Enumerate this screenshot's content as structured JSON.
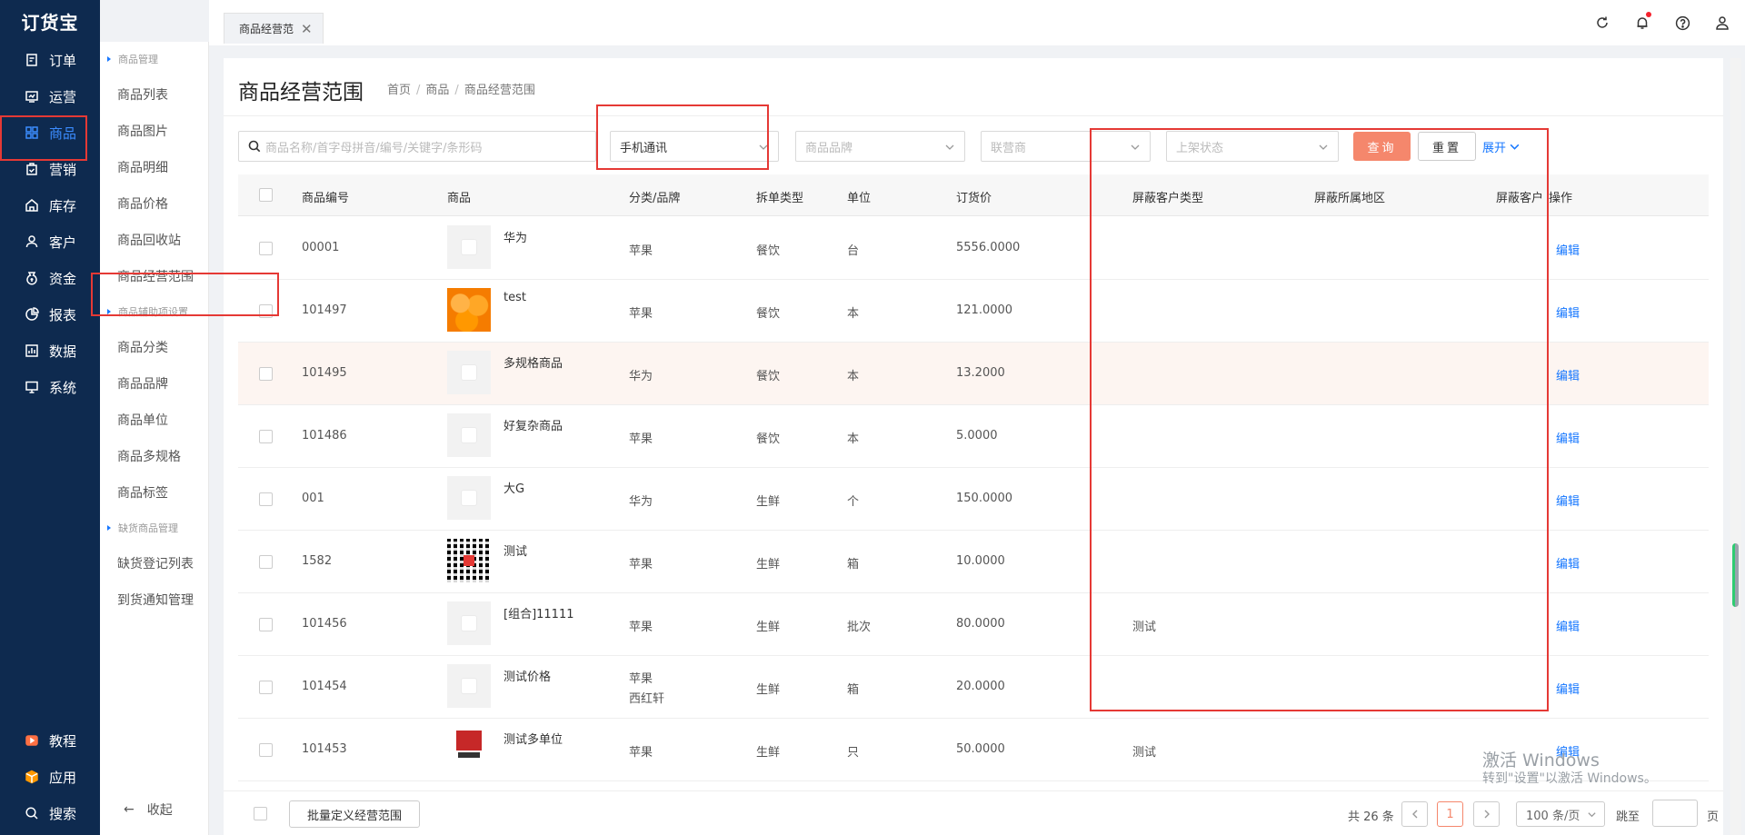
{
  "app": {
    "logo": "订货宝"
  },
  "nav": {
    "items": [
      {
        "label": "订单",
        "icon": "order-icon"
      },
      {
        "label": "运营",
        "icon": "operation-icon"
      },
      {
        "label": "商品",
        "icon": "grid-icon",
        "active": true
      },
      {
        "label": "营销",
        "icon": "marketing-icon"
      },
      {
        "label": "库存",
        "icon": "warehouse-icon"
      },
      {
        "label": "客户",
        "icon": "user-icon"
      },
      {
        "label": "资金",
        "icon": "money-bag-icon"
      },
      {
        "label": "报表",
        "icon": "pie-chart-icon"
      },
      {
        "label": "数据",
        "icon": "data-icon"
      },
      {
        "label": "系统",
        "icon": "monitor-icon"
      }
    ],
    "bottom": [
      {
        "label": "教程",
        "icon": "video-icon"
      },
      {
        "label": "应用",
        "icon": "cube-icon"
      },
      {
        "label": "搜索",
        "icon": "search-icon"
      }
    ]
  },
  "submenu": {
    "group1": "商品管理",
    "items1": [
      "商品列表",
      "商品图片",
      "商品明细",
      "商品价格",
      "商品回收站",
      "商品经营范围"
    ],
    "group2": "商品辅助项设置",
    "items2": [
      "商品分类",
      "商品品牌",
      "商品单位",
      "商品多规格",
      "商品标签"
    ],
    "group3": "缺货商品管理",
    "items3": [
      "缺货登记列表",
      "到货通知管理"
    ],
    "collapse": "收起"
  },
  "tab": {
    "label": "商品经营范",
    "close": "✕"
  },
  "page": {
    "title": "商品经营范围",
    "breadcrumb": [
      "首页",
      "商品",
      "商品经营范围"
    ]
  },
  "filters": {
    "search_placeholder": "商品名称/首字母拼音/编号/关键字/条形码",
    "category_value": "手机通讯",
    "brand_placeholder": "商品品牌",
    "supplier_placeholder": "联营商",
    "status_placeholder": "上架状态",
    "query": "查询",
    "reset": "重置",
    "expand": "展开"
  },
  "table": {
    "headers": [
      "商品编号",
      "商品",
      "分类/品牌",
      "拆单类型",
      "单位",
      "订货价",
      "屏蔽客户类型",
      "屏蔽所属地区",
      "屏蔽客户",
      "操作"
    ],
    "rows": [
      {
        "code": "00001",
        "name": "华为",
        "brand": "苹果",
        "brand2": "",
        "type": "餐饮",
        "unit": "台",
        "price": "5556.0000",
        "block_type": "",
        "edit": "编辑",
        "thumb": "placeholder"
      },
      {
        "code": "101497",
        "name": "test",
        "brand": "苹果",
        "brand2": "",
        "type": "餐饮",
        "unit": "本",
        "price": "121.0000",
        "block_type": "",
        "edit": "编辑",
        "thumb": "orange"
      },
      {
        "code": "101495",
        "name": "多规格商品",
        "brand": "华为",
        "brand2": "",
        "type": "餐饮",
        "unit": "本",
        "price": "13.2000",
        "block_type": "",
        "edit": "编辑",
        "thumb": "placeholder"
      },
      {
        "code": "101486",
        "name": "好复杂商品",
        "brand": "苹果",
        "brand2": "",
        "type": "餐饮",
        "unit": "本",
        "price": "5.0000",
        "block_type": "",
        "edit": "编辑",
        "thumb": "placeholder"
      },
      {
        "code": "001",
        "name": "大G",
        "brand": "华为",
        "brand2": "",
        "type": "生鲜",
        "unit": "个",
        "price": "150.0000",
        "block_type": "",
        "edit": "编辑",
        "thumb": "placeholder"
      },
      {
        "code": "1582",
        "name": "测试",
        "brand": "苹果",
        "brand2": "",
        "type": "生鲜",
        "unit": "箱",
        "price": "10.0000",
        "block_type": "",
        "edit": "编辑",
        "thumb": "qr"
      },
      {
        "code": "101456",
        "name": "[组合]11111",
        "brand": "苹果",
        "brand2": "",
        "type": "生鲜",
        "unit": "批次",
        "price": "80.0000",
        "block_type": "测试",
        "edit": "编辑",
        "thumb": "placeholder"
      },
      {
        "code": "101454",
        "name": "测试价格",
        "brand": "苹果",
        "brand2": "西红轩",
        "type": "生鲜",
        "unit": "箱",
        "price": "20.0000",
        "block_type": "",
        "edit": "编辑",
        "thumb": "placeholder"
      },
      {
        "code": "101453",
        "name": "测试多单位",
        "brand": "苹果",
        "brand2": "",
        "type": "生鲜",
        "unit": "只",
        "price": "50.0000",
        "block_type": "测试",
        "edit": "编辑",
        "thumb": "box"
      }
    ]
  },
  "footer": {
    "batch": "批量定义经营范围",
    "total": "共 26 条",
    "current_page": "1",
    "page_size": "100 条/页",
    "jump": "跳至",
    "page_suffix": "页"
  },
  "watermark": {
    "line1": "激活 Windows",
    "line2": "转到\"设置\"以激活 Windows。"
  },
  "colors": {
    "nav_bg": "#0e2a4f",
    "accent": "#1677ff",
    "primary_btn": "#f5876c",
    "annotation": "#e53935"
  }
}
